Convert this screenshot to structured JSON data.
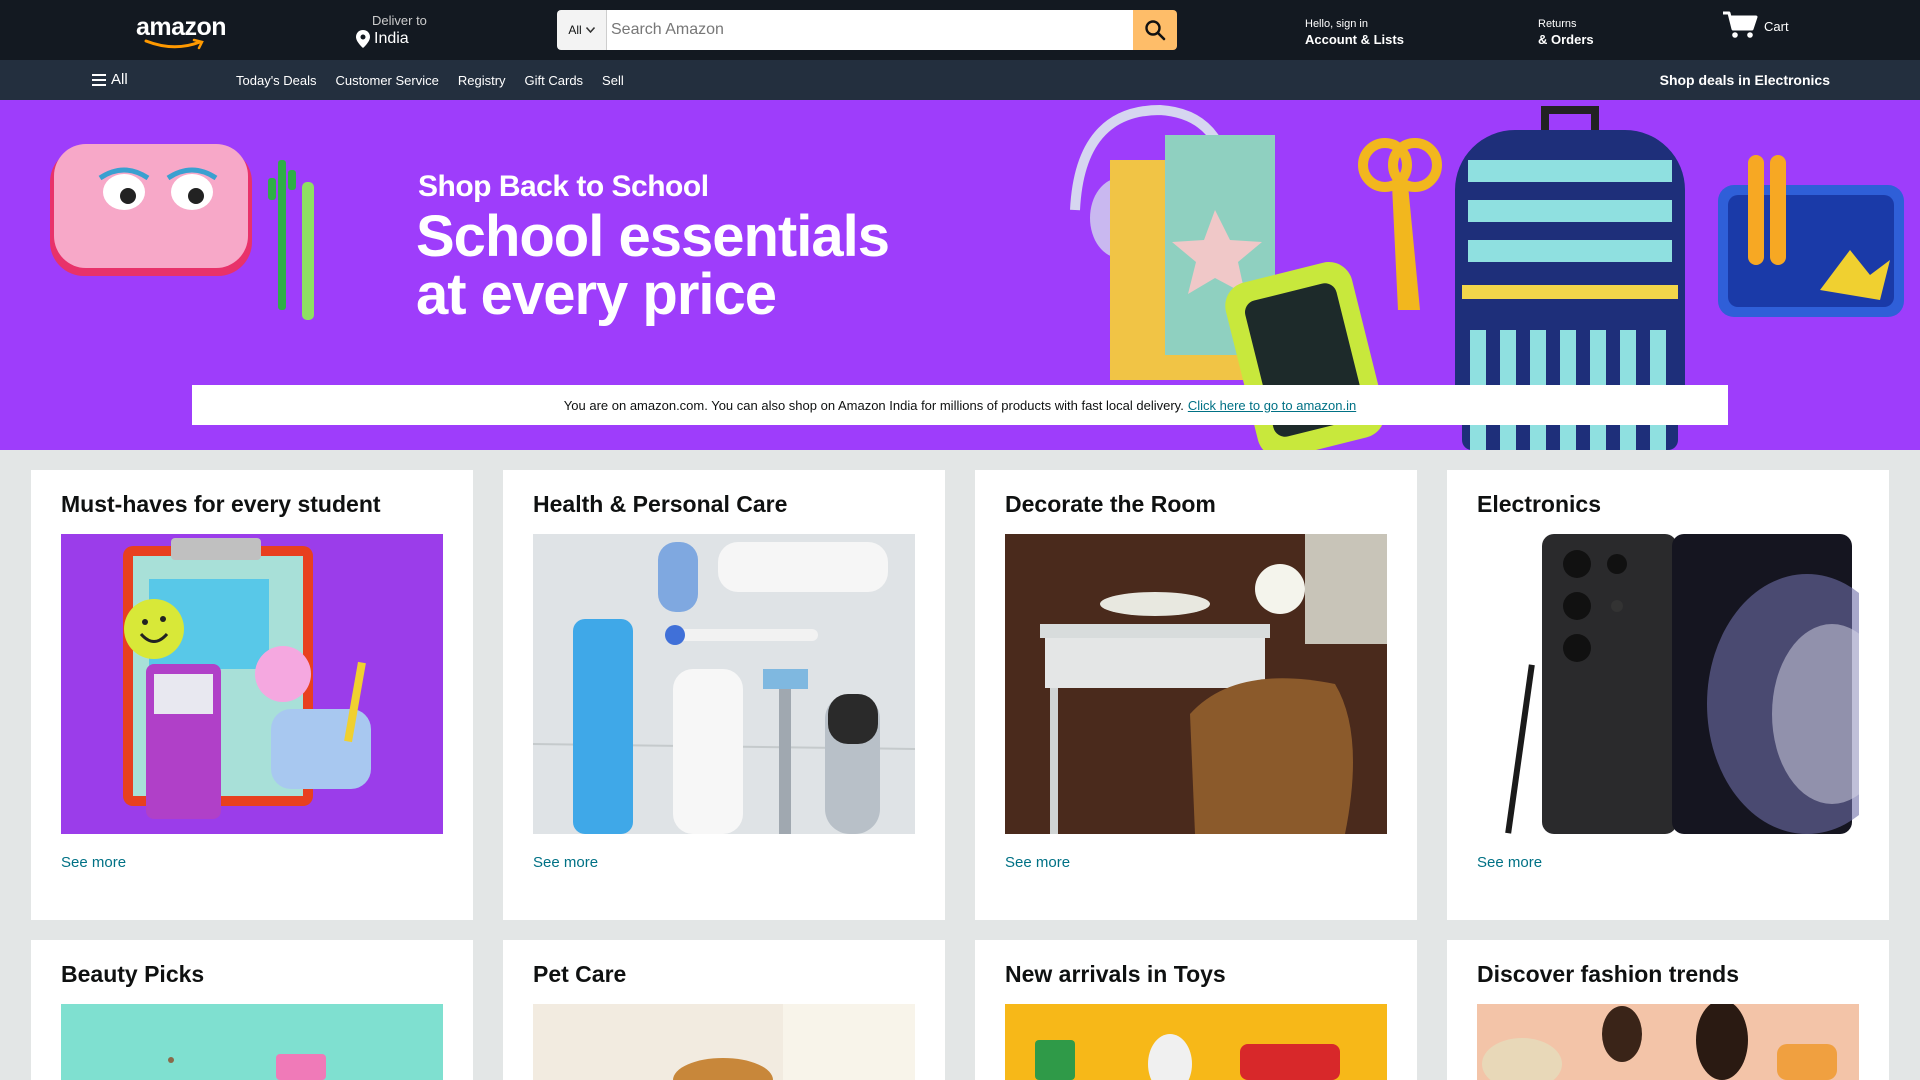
{
  "header": {
    "logo_text": "amazon",
    "deliver_label": "Deliver to",
    "deliver_location": "India",
    "search_category": "All",
    "search_placeholder": "Search Amazon",
    "account_greeting": "Hello, sign in",
    "account_label": "Account & Lists",
    "returns_label": "Returns",
    "orders_label": "& Orders",
    "cart_label": "Cart"
  },
  "subnav": {
    "all_label": "All",
    "links": [
      "Today's Deals",
      "Customer Service",
      "Registry",
      "Gift Cards",
      "Sell"
    ],
    "promo": "Shop deals in Electronics"
  },
  "hero": {
    "kicker": "Shop Back to School",
    "headline_line1": "School essentials",
    "headline_line2": "at every price"
  },
  "notice": {
    "text": "You are on amazon.com. You can also shop on Amazon India for millions of products with fast local delivery.",
    "link": "Click here to go to amazon.in"
  },
  "cards": [
    {
      "title": "Must-haves for every student",
      "link": "See more",
      "icon": "school-supplies-image"
    },
    {
      "title": "Health & Personal Care",
      "link": "See more",
      "icon": "personal-care-image"
    },
    {
      "title": "Decorate the Room",
      "link": "See more",
      "icon": "desk-room-image"
    },
    {
      "title": "Electronics",
      "link": "See more",
      "icon": "smartphone-image"
    },
    {
      "title": "Beauty Picks",
      "icon": "beauty-image"
    },
    {
      "title": "Pet Care",
      "icon": "pet-image"
    },
    {
      "title": "New arrivals in Toys",
      "icon": "toys-image"
    },
    {
      "title": "Discover fashion trends",
      "icon": "fashion-image"
    }
  ],
  "colors": {
    "nav_dark": "#131921",
    "nav_sub": "#232f3e",
    "search_button": "#febd69",
    "hero_purple": "#9e3dfb",
    "link_teal": "#007185",
    "page_bg": "#e3e6e6"
  }
}
